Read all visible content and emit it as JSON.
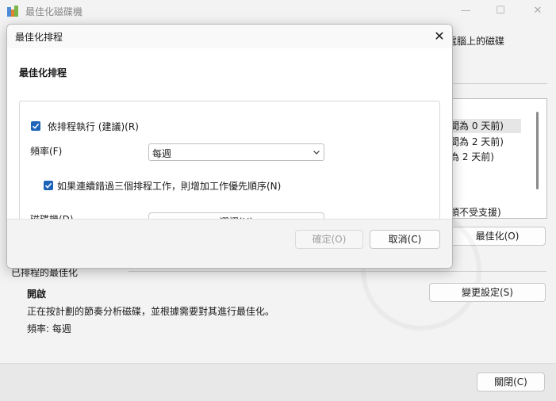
{
  "main": {
    "title": "最佳化磁碟機",
    "desc_fragment": "電腦上的磁碟",
    "drive_rows": [
      "間為 0 天前)",
      "間為 2 天前)",
      "為 2 天前)",
      "類不受支援)"
    ],
    "optimize_label": "最佳化(O)",
    "scheduled_header": "已排程的最佳化",
    "status": "開啟",
    "status_desc": "正在按計劃的節奏分析磁碟，並根據需要對其進行最佳化。",
    "frequency_text": "頻率: 每週",
    "change_settings_label": "變更設定(S)",
    "close_label": "關閉(C)"
  },
  "dialog": {
    "title": "最佳化排程",
    "section_title": "最佳化排程",
    "run_on_schedule_label": "依排程執行 (建議)(R)",
    "run_on_schedule_checked": true,
    "frequency_label": "頻率(F)",
    "frequency_value": "每週",
    "increase_priority_label": "如果連續錯過三個排程工作，則增加工作優先順序(N)",
    "increase_priority_checked": true,
    "drives_label": "磁碟機(D)",
    "choose_label": "選擇(H)",
    "ok_label": "確定(O)",
    "cancel_label": "取消(C)"
  },
  "colors": {
    "accent": "#1d63b8"
  }
}
